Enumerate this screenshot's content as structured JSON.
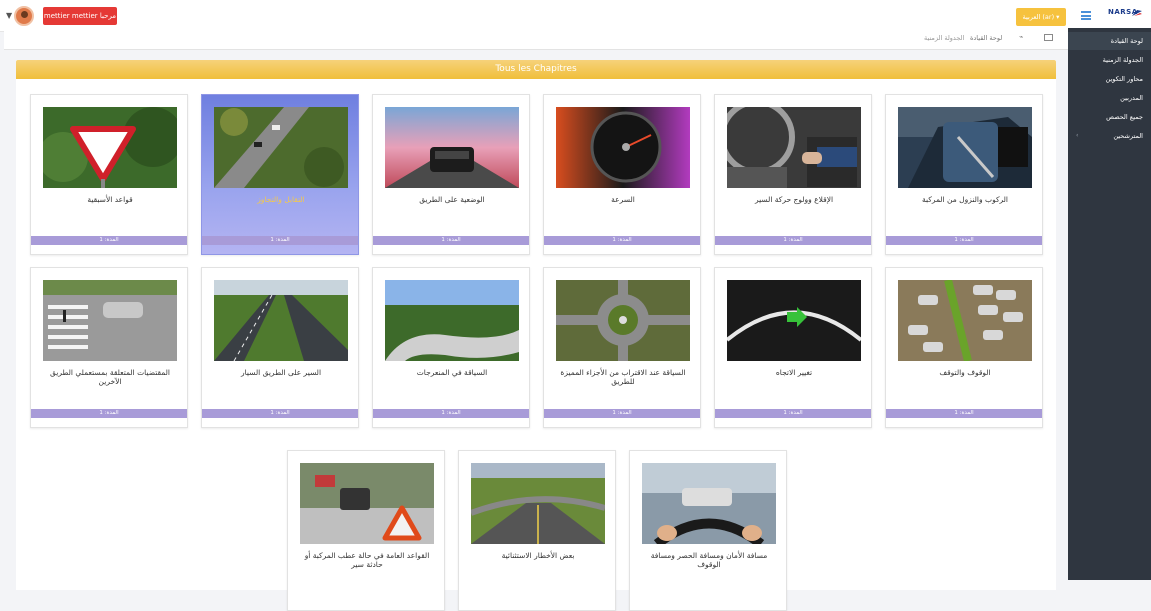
{
  "topbar": {
    "user_button": "mettier mettier مرحبا",
    "lang_button": "العربية (ar) ▾",
    "logo_text": "NARSA"
  },
  "sidebar": {
    "items": [
      {
        "label": "لوحة القيادة",
        "active": true
      },
      {
        "label": "الجدولة الزمنية",
        "active": false
      },
      {
        "label": "محاور التكوين",
        "active": false
      },
      {
        "label": "المدربين",
        "active": false
      },
      {
        "label": "جميع الحصص",
        "active": false
      },
      {
        "label": "المترشحين",
        "active": false
      }
    ]
  },
  "breadcrumb": {
    "home": "لوحة القيادة",
    "current": "الجدولة الزمنية"
  },
  "panel": {
    "title": "Tous les Chapitres"
  },
  "chapters": [
    {
      "title": "الركوب والنزول من المركبة",
      "footer": "المدة: 1",
      "image": "car-interior-seatbelt"
    },
    {
      "title": "الإقلاع وولوج حركة السير",
      "footer": "المدة: 1",
      "image": "gear-shift"
    },
    {
      "title": "السرعة",
      "footer": "المدة: 1",
      "image": "speedometer"
    },
    {
      "title": "الوضعية على الطريق",
      "footer": "المدة: 1",
      "image": "car-on-road"
    },
    {
      "title": "التقابل والتجاوز",
      "footer": "المدة: 1",
      "image": "aerial-highway",
      "highlight": true
    },
    {
      "title": "قواعد الأسبقية",
      "footer": "المدة: 1",
      "image": "yield-sign"
    },
    {
      "title": "الوقوف والتوقف",
      "footer": "المدة: 1",
      "image": "parking-lot"
    },
    {
      "title": "تغيير الاتجاه",
      "footer": "المدة: 1",
      "image": "turn-signal"
    },
    {
      "title": "السياقة عند الاقتراب من الأجزاء المميزة للطريق",
      "footer": "المدة: 1",
      "image": "roundabout"
    },
    {
      "title": "السياقة في المنعرجات",
      "footer": "المدة: 1",
      "image": "curved-road"
    },
    {
      "title": "السير على الطريق السيار",
      "footer": "المدة: 1",
      "image": "motorway"
    },
    {
      "title": "المقتضيات المتعلقة بمستعملي الطريق الآخرين",
      "footer": "المدة: 1",
      "image": "pedestrian-crossing"
    },
    {
      "title": "مسافة الأمان ومسافة الحصر ومسافة الوقوف",
      "footer": "",
      "image": "steering-wheel"
    },
    {
      "title": "بعض الأخطار الاستثنائية",
      "footer": "",
      "image": "highway-interchange"
    },
    {
      "title": "القواعد العامة في حالة عطب المركبة أو حادثة سير",
      "footer": "",
      "image": "warning-triangle"
    }
  ]
}
